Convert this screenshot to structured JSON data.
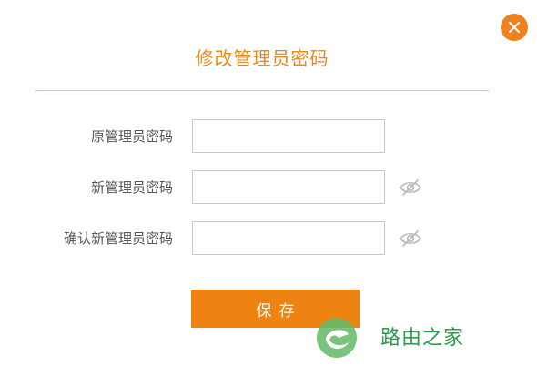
{
  "dialog": {
    "title": "修改管理员密码",
    "close_icon": "close-icon",
    "accent_color": "#ee8220"
  },
  "form": {
    "fields": [
      {
        "label": "原管理员密码",
        "colon": "：",
        "value": "",
        "has_eye_icon": false
      },
      {
        "label": "新管理员密码",
        "colon": "：",
        "value": "",
        "has_eye_icon": true,
        "eye_icon": "eye-hidden-icon"
      },
      {
        "label": "确认新管理员密码",
        "colon": "：",
        "value": "",
        "has_eye_icon": true,
        "eye_icon": "eye-hidden-icon"
      }
    ],
    "save_label": "保存"
  },
  "watermark": {
    "text": "路由之家",
    "color": "#2e9b4a"
  }
}
